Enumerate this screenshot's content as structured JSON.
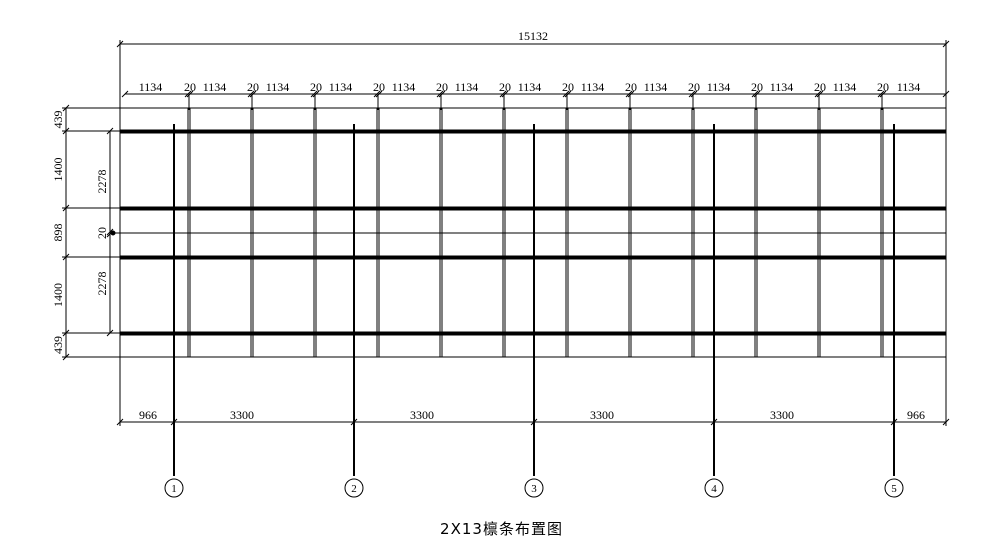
{
  "title": "2X13檩条布置图",
  "top_overall": "15132",
  "top_segments": [
    "1134",
    "20",
    "1134",
    "20",
    "1134",
    "20",
    "1134",
    "20",
    "1134",
    "20",
    "1134",
    "20",
    "1134",
    "20",
    "1134",
    "20",
    "1134",
    "20",
    "1134",
    "20",
    "1134",
    "20",
    "1134",
    "20",
    "1134"
  ],
  "left_outer": [
    "439",
    "1400",
    "898",
    "1400",
    "439"
  ],
  "left_inner": [
    "2278",
    "20",
    "2278"
  ],
  "bottom_segments": [
    "966",
    "3300",
    "3300",
    "3300",
    "3300",
    "966"
  ],
  "axis_labels": [
    "1",
    "2",
    "3",
    "4",
    "5"
  ]
}
